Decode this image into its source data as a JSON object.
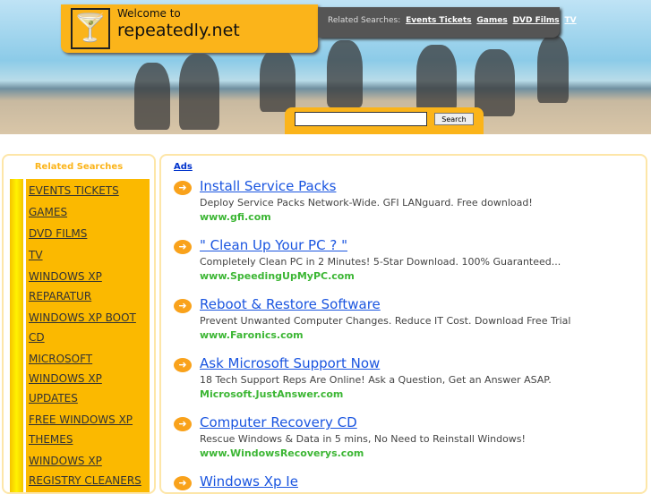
{
  "header": {
    "welcome": "Welcome to",
    "site": "repeatedly.net",
    "related_label": "Related Searches:",
    "related_links": [
      "Events Tickets",
      "Games",
      "DVD Films",
      "TV"
    ],
    "search_button": "Search",
    "search_value": ""
  },
  "sidebar": {
    "title": "Related Searches",
    "items": [
      "EVENTS TICKETS",
      "GAMES",
      "DVD FILMS",
      "TV",
      "WINDOWS XP REPARATUR",
      "WINDOWS XP BOOT CD",
      "MICROSOFT WINDOWS XP UPDATES",
      "FREE WINDOWS XP THEMES",
      "WINDOWS XP REGISTRY CLEANERS"
    ]
  },
  "main": {
    "ads_label": "Ads",
    "ads": [
      {
        "title": "Install Service Packs",
        "desc": "Deploy Service Packs Network-Wide. GFI LANguard. Free download!",
        "url": "www.gfi.com"
      },
      {
        "title": "\" Clean Up Your PC ? \"",
        "desc": "Completely Clean PC in 2 Minutes! 5-Star Download. 100% Guaranteed...",
        "url": "www.SpeedingUpMyPC.com"
      },
      {
        "title": "Reboot & Restore Software",
        "desc": "Prevent Unwanted Computer Changes. Reduce IT Cost. Download Free Trial",
        "url": "www.Faronics.com"
      },
      {
        "title": "Ask Microsoft Support Now",
        "desc": "18 Tech Support Reps Are Online! Ask a Question, Get an Answer ASAP.",
        "url": "Microsoft.JustAnswer.com"
      },
      {
        "title": "Computer Recovery CD",
        "desc": "Rescue Windows & Data in 5 mins, No Need to Reinstall Windows!",
        "url": "www.WindowsRecoverys.com"
      },
      {
        "title": "Windows Xp Ie",
        "desc": "",
        "url": ""
      }
    ]
  }
}
